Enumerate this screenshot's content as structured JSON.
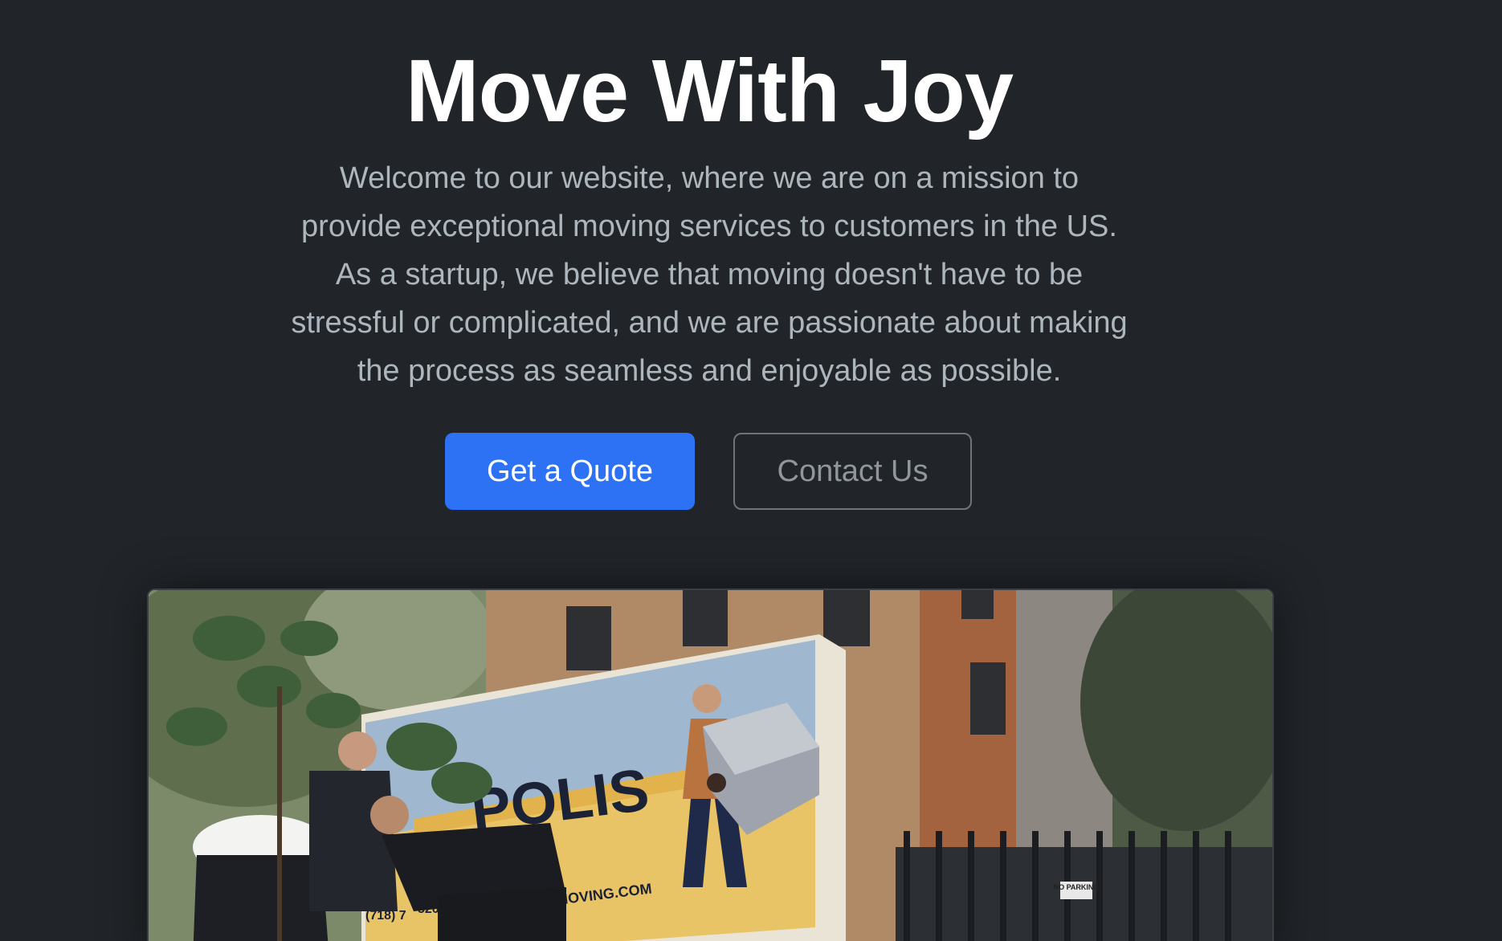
{
  "hero": {
    "title": "Move With Joy",
    "lead": "Welcome to our website, where we are on a mission to provide exceptional moving services to customers in the US. As a startup, we believe that moving doesn't have to be stressful or complicated, and we are passionate about making the process as seamless and enjoyable as possible."
  },
  "buttons": {
    "primary_label": "Get a Quote",
    "secondary_label": "Contact Us"
  },
  "photo": {
    "truck_text": "POLIS",
    "truck_url_text": "MOVING.COM",
    "truck_phone_text": "(718) 7",
    "truck_partial_text": "520",
    "sign_text": "NO PARKING"
  },
  "colors": {
    "background": "#212529",
    "primary": "#2d72f5",
    "lead_text": "#adb5bd"
  }
}
